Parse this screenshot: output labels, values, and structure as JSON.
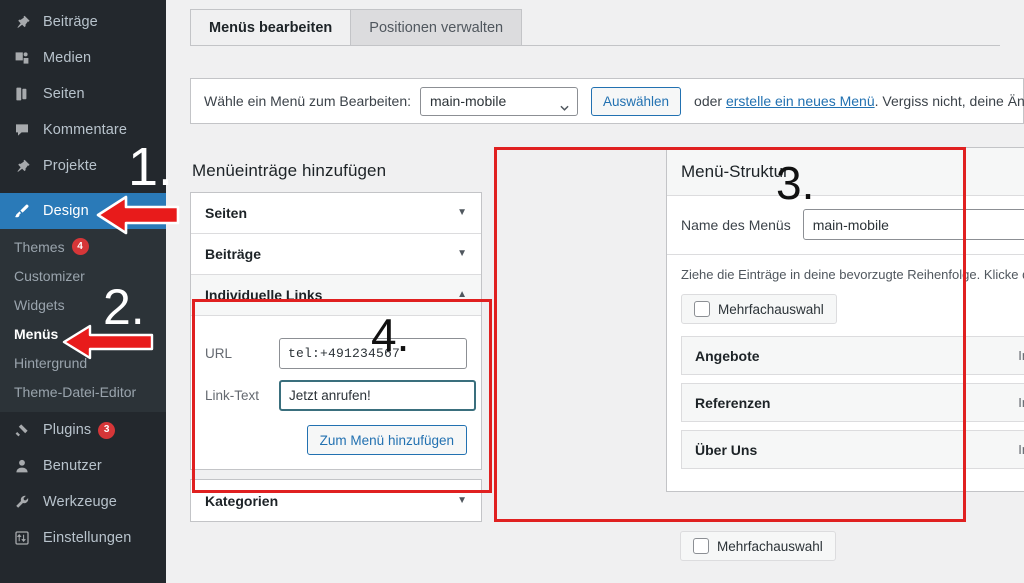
{
  "sidebar": {
    "top_items": [
      {
        "label": "Beiträge",
        "icon": "pin-icon"
      },
      {
        "label": "Medien",
        "icon": "media-icon"
      },
      {
        "label": "Seiten",
        "icon": "pages-icon"
      },
      {
        "label": "Kommentare",
        "icon": "comment-icon"
      },
      {
        "label": "Projekte",
        "icon": "pin-icon"
      }
    ],
    "design_item": {
      "label": "Design",
      "icon": "brush-icon"
    },
    "design_subitems": [
      {
        "label": "Themes",
        "badge": "4",
        "current": false
      },
      {
        "label": "Customizer",
        "badge": "",
        "current": false
      },
      {
        "label": "Widgets",
        "badge": "",
        "current": false
      },
      {
        "label": "Menüs",
        "badge": "",
        "current": true
      },
      {
        "label": "Hintergrund",
        "badge": "",
        "current": false
      },
      {
        "label": "Theme-Datei-Editor",
        "badge": "",
        "current": false
      }
    ],
    "bottom_items": [
      {
        "label": "Plugins",
        "icon": "plug-icon",
        "badge": "3"
      },
      {
        "label": "Benutzer",
        "icon": "user-icon",
        "badge": ""
      },
      {
        "label": "Werkzeuge",
        "icon": "wrench-icon",
        "badge": ""
      },
      {
        "label": "Einstellungen",
        "icon": "settings-icon",
        "badge": ""
      }
    ]
  },
  "tabs": [
    {
      "label": "Menüs bearbeiten",
      "active": true
    },
    {
      "label": "Positionen verwalten",
      "active": false
    }
  ],
  "menu_bar": {
    "label": "Wähle ein Menü zum Bearbeiten:",
    "selected_menu": "main-mobile",
    "options": [
      "main-mobile"
    ],
    "select_button": "Auswählen",
    "after_text_before_link": "oder ",
    "link_text": "erstelle ein neues Menü",
    "after_text": ". Vergiss nicht, deine Änderunge"
  },
  "left_panel": {
    "heading": "Menüeinträge hinzufügen",
    "accordions": [
      {
        "label": "Seiten",
        "open": false
      },
      {
        "label": "Beiträge",
        "open": false
      }
    ],
    "custom_links": {
      "label": "Individuelle Links",
      "url_label": "URL",
      "url_value": "tel:+491234567",
      "linktext_label": "Link-Text",
      "linktext_value": "Jetzt anrufen!",
      "add_button": "Zum Menü hinzufügen"
    },
    "categories": {
      "label": "Kategorien",
      "open": false
    }
  },
  "right_panel": {
    "title": "Menü-Struktur",
    "name_label": "Name des Menüs",
    "name_value": "main-mobile",
    "hint": "Ziehe die Einträge in deine bevorzugte Reihenfolge. Klicke den Pfeil auf der rechten Se",
    "bulk_label": "Mehrfachauswahl",
    "bulk_label_bottom": "Mehrfachauswahl",
    "menu_items": [
      {
        "title": "Angebote",
        "type": "Individueller Link"
      },
      {
        "title": "Referenzen",
        "type": "Individueller Link"
      },
      {
        "title": "Über Uns",
        "type": "Individueller Link"
      }
    ]
  },
  "annotations": {
    "numbers": [
      {
        "text": "1.",
        "id": "step-1"
      },
      {
        "text": "2.",
        "id": "step-2"
      },
      {
        "text": "3.",
        "id": "step-3"
      },
      {
        "text": "4.",
        "id": "step-4"
      }
    ],
    "box_color": "#e02020",
    "arrow_color": "#e81b1b"
  }
}
